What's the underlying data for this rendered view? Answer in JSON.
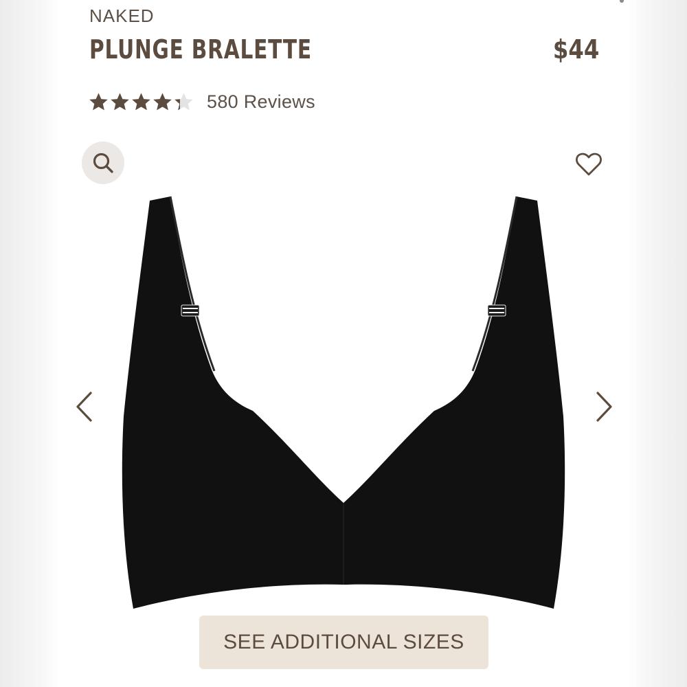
{
  "product": {
    "brand": "NAKED",
    "name": "PLUNGE BRALETTE",
    "price": "$44",
    "rating": {
      "value": 4.3,
      "max": 5,
      "reviews_label": "580 Reviews"
    }
  },
  "gallery": {
    "zoom_icon": "search-icon",
    "wishlist_icon": "heart-outline-icon",
    "prev_icon": "chevron-left-icon",
    "next_icon": "chevron-right-icon",
    "image": "black-plunge-bralette-product-photo"
  },
  "actions": {
    "sizes_label": "SEE ADDITIONAL SIZES"
  },
  "colors": {
    "text": "#5b4c3f",
    "star_filled": "#5b4c3f",
    "star_empty": "#e3e3e3",
    "button_bg": "#ede4d9",
    "zoom_bg": "#ebe8e6",
    "garment": "#111111"
  }
}
